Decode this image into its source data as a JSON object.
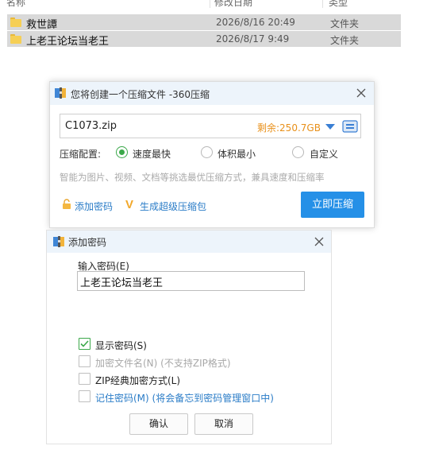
{
  "explorer": {
    "columns": [
      "名称",
      "修改日期",
      "类型"
    ],
    "rows": [
      {
        "name": "救世譚",
        "date": "2026/8/16 20:49",
        "type": "文件夹",
        "icon": "folder-icon"
      },
      {
        "name": "上老王论坛当老王",
        "date": "2026/8/17 9:49",
        "type": "文件夹",
        "icon": "folder-icon"
      }
    ]
  },
  "zip_dialog": {
    "title": "您将创建一个压缩文件 -360压缩",
    "filename": "C1073.zip",
    "free_space": "剩余:250.7GB",
    "config_label": "压缩配置:",
    "options": [
      "速度最快",
      "体积最小",
      "自定义"
    ],
    "selected_option": "速度最快",
    "hint": "智能为图片、视频、文档等挑选最优压缩方式，兼具速度和压缩率",
    "add_password": "添加密码",
    "vip_glyph": "V",
    "super_archive": "生成超级压缩包",
    "compress_button": "立即压缩",
    "accent_color": "#2590e7"
  },
  "password_dialog": {
    "title": "添加密码",
    "input_label": "输入密码(E)",
    "password_value": "上老王论坛当老王",
    "checkboxes": [
      {
        "label": "显示密码(S)",
        "checked": true
      },
      {
        "label": "加密文件名(N)",
        "note": "(不支持ZIP格式)",
        "checked": false,
        "disabled": true
      },
      {
        "label": "ZIP经典加密方式(L)",
        "checked": false
      },
      {
        "label": "记住密码(M)",
        "note": "(将会备忘到密码管理窗口中)",
        "checked": false
      }
    ],
    "ok_button": "确认",
    "cancel_button": "取消",
    "check_color": "#3ba84a"
  }
}
